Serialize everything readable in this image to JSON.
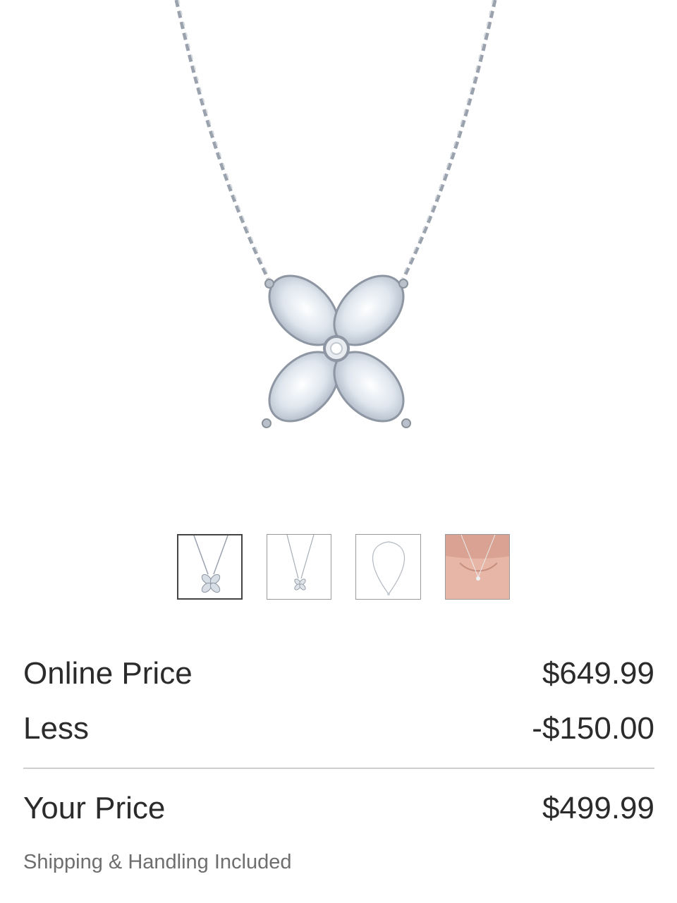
{
  "product": {
    "main_image": "pendant-necklace-image",
    "thumbnails": [
      {
        "name": "thumbnail-front",
        "active": true
      },
      {
        "name": "thumbnail-side",
        "active": false
      },
      {
        "name": "thumbnail-full-chain",
        "active": false
      },
      {
        "name": "thumbnail-on-model",
        "active": false
      }
    ]
  },
  "pricing": {
    "online_price_label": "Online Price",
    "online_price_value": "$649.99",
    "less_label": "Less",
    "less_value": "-$150.00",
    "your_price_label": "Your Price",
    "your_price_value": "$499.99",
    "shipping_note": "Shipping & Handling Included"
  }
}
